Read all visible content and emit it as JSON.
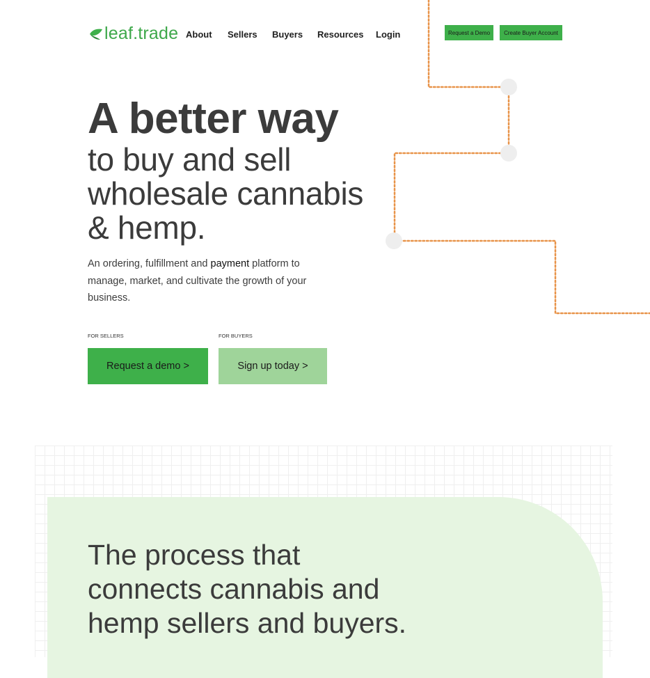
{
  "brand": {
    "name": "leaf.trade",
    "logo_icon": "leaf-icon",
    "accent": "#3eb04a"
  },
  "nav": {
    "items": [
      "About",
      "Sellers",
      "Buyers",
      "Resources",
      "Login"
    ],
    "request_demo": "Request a Demo",
    "create_buyer": "Create Buyer Account"
  },
  "hero": {
    "headline_bold": "A better way",
    "headline_lines": [
      "to buy and sell",
      "wholesale cannabis",
      "& hemp."
    ],
    "description_before": "An ordering, fulfillment and ",
    "description_highlight": "payment",
    "description_after": " platform to manage, market, and cultivate the growth of your business.",
    "sellers_label": "FOR SELLERS",
    "buyers_label": "FOR BUYERS",
    "request_demo_cta": "Request a demo >",
    "signup_cta": "Sign up today >"
  },
  "process": {
    "lines": [
      "The process that",
      "connects cannabis and",
      "hemp sellers and buyers."
    ]
  },
  "colors": {
    "green": "#3eb04a",
    "light_green": "#9fd49a",
    "card_bg": "#e6f5e1",
    "dotted_line": "#e8944a",
    "text": "#3b3b3b"
  }
}
